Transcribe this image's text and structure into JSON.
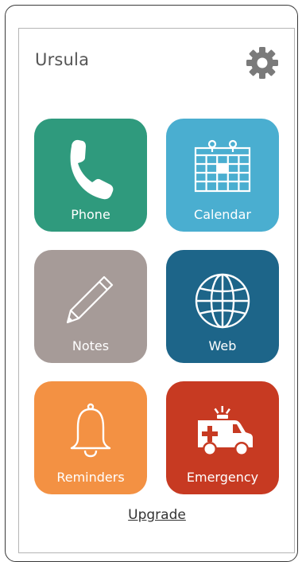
{
  "user": {
    "name": "Ursula"
  },
  "settings": {
    "icon": "gear-icon",
    "color": "#7a7a7a"
  },
  "tiles": [
    {
      "label": "Phone",
      "icon": "phone-icon",
      "color": "#2f9a7d"
    },
    {
      "label": "Calendar",
      "icon": "calendar-icon",
      "color": "#4aaed0"
    },
    {
      "label": "Notes",
      "icon": "pencil-icon",
      "color": "#a69b98"
    },
    {
      "label": "Web",
      "icon": "globe-icon",
      "color": "#1d6589"
    },
    {
      "label": "Reminders",
      "icon": "bell-icon",
      "color": "#f39143"
    },
    {
      "label": "Emergency",
      "icon": "ambulance-icon",
      "color": "#c73a22"
    }
  ],
  "footer": {
    "upgrade_label": "Upgrade"
  }
}
